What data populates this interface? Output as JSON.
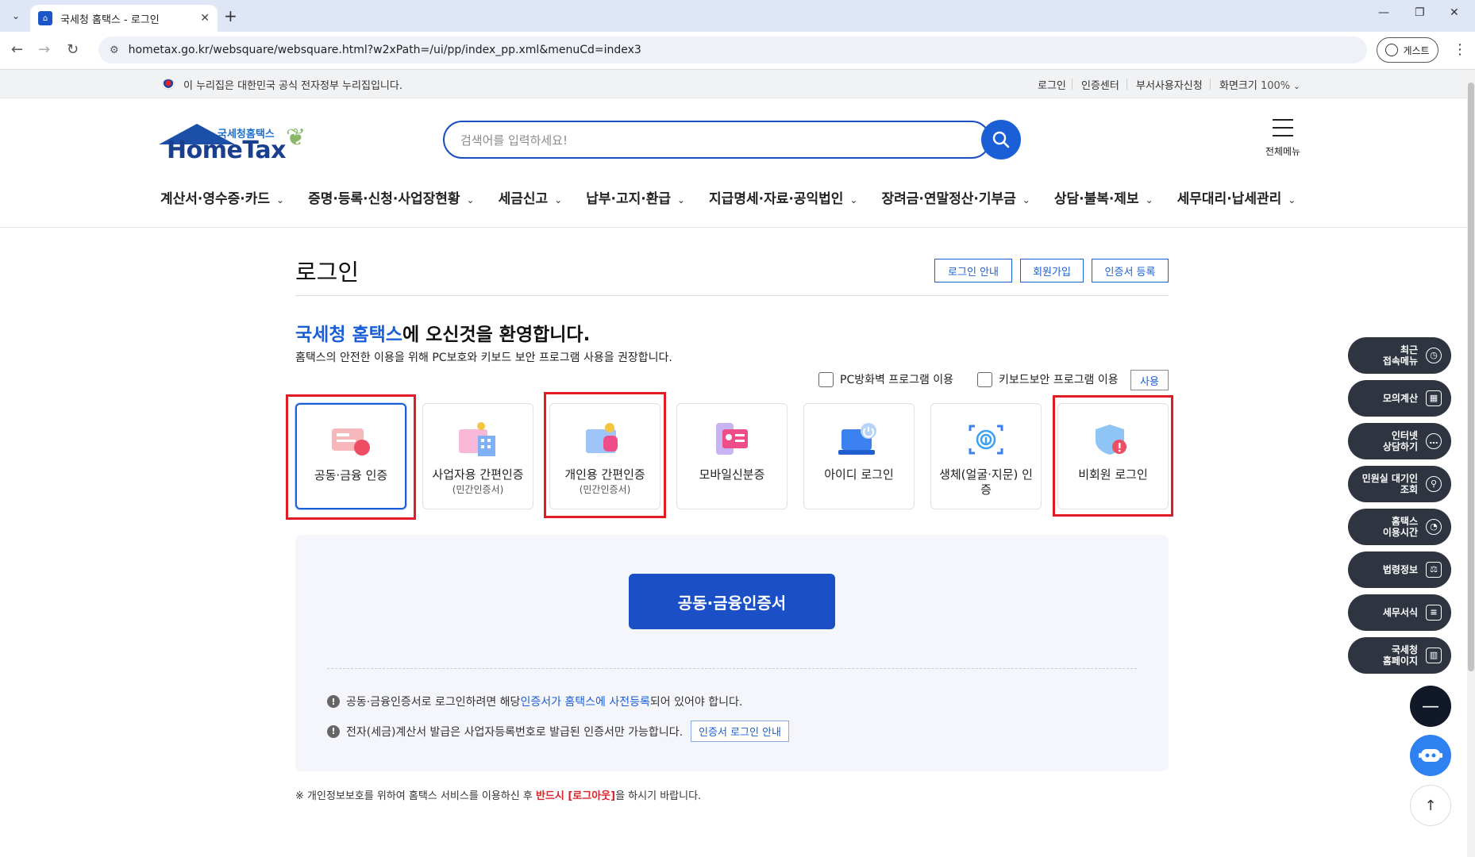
{
  "browser": {
    "tab_title": "국세청 홈택스 - 로그인",
    "url": "hometax.go.kr/websquare/websquare.html?w2xPath=/ui/pp/index_pp.xml&menuCd=index3",
    "profile_label": "게스트"
  },
  "govbar": {
    "notice": "이 누리집은 대한민국 공식 전자정부 누리집입니다.",
    "links": [
      "로그인",
      "인증센터",
      "부서사용자신청"
    ],
    "zoom_label": "화면크기",
    "zoom_value": "100%"
  },
  "header": {
    "logo_small": "국세청홈택스",
    "logo_big": "HomeTax",
    "search_placeholder": "검색어를 입력하세요!",
    "all_menu_label": "전체메뉴"
  },
  "gnb": [
    "계산서·영수증·카드",
    "증명·등록·신청·사업장현황",
    "세금신고",
    "납부·고지·환급",
    "지급명세·자료·공익법인",
    "장려금·연말정산·기부금",
    "상담·불복·제보",
    "세무대리·납세관리"
  ],
  "login": {
    "title": "로그인",
    "top_buttons": [
      "로그인 안내",
      "회원가입",
      "인증서 등록"
    ],
    "welcome_highlight": "국세청 홈택스",
    "welcome_rest": "에 오신것을 환영합니다.",
    "subdesc": "홈택스의 안전한 이용을 위해 PC보호와 키보드 보안 프로그램 사용을 권장합니다.",
    "chk_firewall": "PC방화벽 프로그램 이용",
    "chk_keyboard": "키보드보안 프로그램 이용",
    "use_button": "사용",
    "methods": [
      {
        "label": "공동·금융 인증",
        "sub": ""
      },
      {
        "label": "사업자용 간편인증",
        "sub": "(민간인증서)"
      },
      {
        "label": "개인용 간편인증",
        "sub": "(민간인증서)"
      },
      {
        "label": "모바일신분증",
        "sub": ""
      },
      {
        "label": "아이디 로그인",
        "sub": ""
      },
      {
        "label": "생체(얼굴·지문) 인증",
        "sub": ""
      },
      {
        "label": "비회원 로그인",
        "sub": ""
      }
    ],
    "main_button": "공동·금융인증서",
    "note1_pre": "공동·금융인증서로 로그인하려면 해당 ",
    "note1_link": "인증서가 홈택스에 사전등록",
    "note1_post": "되어 있어야 합니다.",
    "note2": "전자(세금)계산서 발급은 사업자등록번호로 발급된 인증서만 가능합니다.",
    "note2_button": "인증서 로그인 안내",
    "footer_pre": "※ 개인정보보호를 위하여 홈택스 서비스를 이용하신 후 ",
    "footer_red": "반드시 [로그아웃]",
    "footer_post": "을 하시기 바랍니다."
  },
  "quick_menu": [
    {
      "l1": "최근",
      "l2": "접속메뉴",
      "icon": "clock-icon"
    },
    {
      "l1": "모의계산",
      "l2": "",
      "icon": "calculator-icon"
    },
    {
      "l1": "인터넷",
      "l2": "상담하기",
      "icon": "chat-icon"
    },
    {
      "l1": "민원실 대기인",
      "l2": "조회",
      "icon": "person-search-icon"
    },
    {
      "l1": "홈택스",
      "l2": "이용시간",
      "icon": "alarm-icon"
    },
    {
      "l1": "법령정보",
      "l2": "",
      "icon": "gavel-icon"
    },
    {
      "l1": "세무서식",
      "l2": "",
      "icon": "document-icon"
    },
    {
      "l1": "국세청",
      "l2": "홈페이지",
      "icon": "building-icon"
    }
  ],
  "colors": {
    "brand_blue": "#1a5fd6",
    "dark_btn": "#1a4fc6",
    "highlight_red": "#e01b24"
  }
}
